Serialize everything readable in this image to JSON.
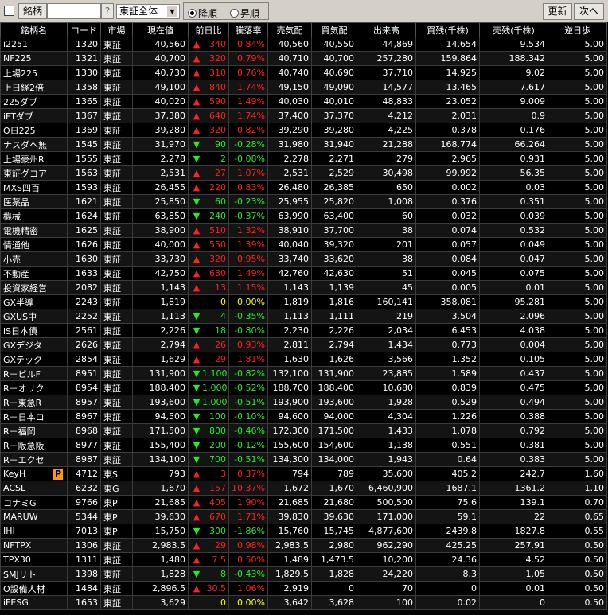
{
  "toolbar": {
    "name_label": "銘柄",
    "name_input_value": "",
    "help_label": "?",
    "market_select": "東証全体",
    "sort_desc": "降順",
    "sort_asc": "昇順",
    "refresh": "更新",
    "next": "次へ"
  },
  "columns": [
    "銘柄名",
    "コード",
    "市場",
    "現在値",
    "前日比",
    "騰落率",
    "売気配",
    "買気配",
    "出来高",
    "買残(千株)",
    "売残(千株)",
    "逆日歩"
  ],
  "rows": [
    {
      "name": "i2251",
      "code": "1320",
      "market": "東証",
      "price": "40,560",
      "dir": "up",
      "change": "340",
      "rate": "0.84%",
      "ask": "40,560",
      "bid": "40,550",
      "volume": "44,869",
      "buy_rem": "14.654",
      "sell_rem": "9.534",
      "fee": "5.00"
    },
    {
      "name": "NF225",
      "code": "1321",
      "market": "東証",
      "price": "40,700",
      "dir": "up",
      "change": "320",
      "rate": "0.79%",
      "ask": "40,710",
      "bid": "40,700",
      "volume": "257,280",
      "buy_rem": "159.864",
      "sell_rem": "188.342",
      "fee": "5.00"
    },
    {
      "name": "上場225",
      "code": "1330",
      "market": "東証",
      "price": "40,730",
      "dir": "up",
      "change": "310",
      "rate": "0.76%",
      "ask": "40,740",
      "bid": "40,690",
      "volume": "37,710",
      "buy_rem": "14.925",
      "sell_rem": "9.02",
      "fee": "5.00"
    },
    {
      "name": "上日経2倍",
      "code": "1358",
      "market": "東証",
      "price": "49,100",
      "dir": "up",
      "change": "840",
      "rate": "1.74%",
      "ask": "49,150",
      "bid": "49,090",
      "volume": "14,577",
      "buy_rem": "13.465",
      "sell_rem": "7.617",
      "fee": "5.00"
    },
    {
      "name": "225ダブ",
      "code": "1365",
      "market": "東証",
      "price": "40,020",
      "dir": "up",
      "change": "590",
      "rate": "1.49%",
      "ask": "40,030",
      "bid": "40,010",
      "volume": "48,833",
      "buy_rem": "23.052",
      "sell_rem": "9.009",
      "fee": "5.00"
    },
    {
      "name": "iFTダブ",
      "code": "1367",
      "market": "東証",
      "price": "37,380",
      "dir": "up",
      "change": "640",
      "rate": "1.74%",
      "ask": "37,400",
      "bid": "37,370",
      "volume": "4,212",
      "buy_rem": "2.031",
      "sell_rem": "0.9",
      "fee": "5.00"
    },
    {
      "name": "O日225",
      "code": "1369",
      "market": "東証",
      "price": "39,280",
      "dir": "up",
      "change": "320",
      "rate": "0.82%",
      "ask": "39,290",
      "bid": "39,280",
      "volume": "4,225",
      "buy_rem": "0.378",
      "sell_rem": "0.176",
      "fee": "5.00"
    },
    {
      "name": "ナスダヘ無",
      "code": "1545",
      "market": "東証",
      "price": "31,970",
      "dir": "dn",
      "change": "90",
      "rate": "-0.28%",
      "ask": "31,980",
      "bid": "31,940",
      "volume": "21,288",
      "buy_rem": "168.774",
      "sell_rem": "66.264",
      "fee": "5.00"
    },
    {
      "name": "上場豪州R",
      "code": "1555",
      "market": "東証",
      "price": "2,278",
      "dir": "dn",
      "change": "2",
      "rate": "-0.08%",
      "ask": "2,278",
      "bid": "2,271",
      "volume": "279",
      "buy_rem": "2.965",
      "sell_rem": "0.931",
      "fee": "5.00"
    },
    {
      "name": "東証グコア",
      "code": "1563",
      "market": "東証",
      "price": "2,531",
      "dir": "up",
      "change": "27",
      "rate": "1.07%",
      "ask": "2,531",
      "bid": "2,529",
      "volume": "30,498",
      "buy_rem": "99.992",
      "sell_rem": "56.35",
      "fee": "5.00"
    },
    {
      "name": "MXS四百",
      "code": "1593",
      "market": "東証",
      "price": "26,455",
      "dir": "up",
      "change": "220",
      "rate": "0.83%",
      "ask": "26,480",
      "bid": "26,385",
      "volume": "650",
      "buy_rem": "0.002",
      "sell_rem": "0.03",
      "fee": "5.00"
    },
    {
      "name": "医薬品",
      "code": "1621",
      "market": "東証",
      "price": "25,850",
      "dir": "dn",
      "change": "60",
      "rate": "-0.23%",
      "ask": "25,955",
      "bid": "25,820",
      "volume": "1,008",
      "buy_rem": "0.376",
      "sell_rem": "0.351",
      "fee": "5.00"
    },
    {
      "name": "機械",
      "code": "1624",
      "market": "東証",
      "price": "63,850",
      "dir": "dn",
      "change": "240",
      "rate": "-0.37%",
      "ask": "63,990",
      "bid": "63,400",
      "volume": "60",
      "buy_rem": "0.032",
      "sell_rem": "0.039",
      "fee": "5.00"
    },
    {
      "name": "電機精密",
      "code": "1625",
      "market": "東証",
      "price": "38,900",
      "dir": "up",
      "change": "510",
      "rate": "1.32%",
      "ask": "38,910",
      "bid": "37,700",
      "volume": "38",
      "buy_rem": "0.074",
      "sell_rem": "0.532",
      "fee": "5.00"
    },
    {
      "name": "情通他",
      "code": "1626",
      "market": "東証",
      "price": "40,000",
      "dir": "up",
      "change": "550",
      "rate": "1.39%",
      "ask": "40,040",
      "bid": "39,320",
      "volume": "201",
      "buy_rem": "0.057",
      "sell_rem": "0.049",
      "fee": "5.00"
    },
    {
      "name": "小売",
      "code": "1630",
      "market": "東証",
      "price": "33,730",
      "dir": "up",
      "change": "320",
      "rate": "0.95%",
      "ask": "33,740",
      "bid": "33,620",
      "volume": "38",
      "buy_rem": "0.084",
      "sell_rem": "0.047",
      "fee": "5.00"
    },
    {
      "name": "不動産",
      "code": "1633",
      "market": "東証",
      "price": "42,750",
      "dir": "up",
      "change": "630",
      "rate": "1.49%",
      "ask": "42,760",
      "bid": "42,630",
      "volume": "51",
      "buy_rem": "0.045",
      "sell_rem": "0.075",
      "fee": "5.00"
    },
    {
      "name": "投資家経営",
      "code": "2082",
      "market": "東証",
      "price": "1,143",
      "dir": "up",
      "change": "13",
      "rate": "1.15%",
      "ask": "1,143",
      "bid": "1,139",
      "volume": "45",
      "buy_rem": "0.005",
      "sell_rem": "0.01",
      "fee": "5.00"
    },
    {
      "name": "GX半導",
      "code": "2243",
      "market": "東証",
      "price": "1,819",
      "dir": "flat",
      "change": "0",
      "rate": "0.00%",
      "ask": "1,819",
      "bid": "1,816",
      "volume": "160,141",
      "buy_rem": "358.081",
      "sell_rem": "95.281",
      "fee": "5.00"
    },
    {
      "name": "GXUS中",
      "code": "2252",
      "market": "東証",
      "price": "1,113",
      "dir": "dn",
      "change": "4",
      "rate": "-0.35%",
      "ask": "1,113",
      "bid": "1,111",
      "volume": "219",
      "buy_rem": "3.504",
      "sell_rem": "2.096",
      "fee": "5.00"
    },
    {
      "name": "iS日本債",
      "code": "2561",
      "market": "東証",
      "price": "2,226",
      "dir": "dn",
      "change": "18",
      "rate": "-0.80%",
      "ask": "2,230",
      "bid": "2,226",
      "volume": "2,034",
      "buy_rem": "6.453",
      "sell_rem": "4.038",
      "fee": "5.00"
    },
    {
      "name": "GXデジタ",
      "code": "2626",
      "market": "東証",
      "price": "2,794",
      "dir": "up",
      "change": "26",
      "rate": "0.93%",
      "ask": "2,811",
      "bid": "2,794",
      "volume": "1,434",
      "buy_rem": "0.773",
      "sell_rem": "0.004",
      "fee": "5.00"
    },
    {
      "name": "GXテック",
      "code": "2854",
      "market": "東証",
      "price": "1,629",
      "dir": "up",
      "change": "29",
      "rate": "1.81%",
      "ask": "1,630",
      "bid": "1,626",
      "volume": "3,566",
      "buy_rem": "1.352",
      "sell_rem": "0.105",
      "fee": "5.00"
    },
    {
      "name": "R－ビルF",
      "code": "8951",
      "market": "東証",
      "price": "131,900",
      "dir": "dn",
      "change": "1,100",
      "rate": "-0.82%",
      "ask": "132,100",
      "bid": "131,900",
      "volume": "23,885",
      "buy_rem": "1.589",
      "sell_rem": "0.437",
      "fee": "5.00"
    },
    {
      "name": "R－オリク",
      "code": "8954",
      "market": "東証",
      "price": "188,400",
      "dir": "dn",
      "change": "1,000",
      "rate": "-0.52%",
      "ask": "188,700",
      "bid": "188,400",
      "volume": "10,680",
      "buy_rem": "0.839",
      "sell_rem": "0.475",
      "fee": "5.00"
    },
    {
      "name": "R－東急R",
      "code": "8957",
      "market": "東証",
      "price": "193,600",
      "dir": "dn",
      "change": "1,000",
      "rate": "-0.51%",
      "ask": "193,900",
      "bid": "193,600",
      "volume": "1,928",
      "buy_rem": "0.529",
      "sell_rem": "0.494",
      "fee": "5.00"
    },
    {
      "name": "R－日本ロ",
      "code": "8967",
      "market": "東証",
      "price": "94,500",
      "dir": "dn",
      "change": "100",
      "rate": "-0.10%",
      "ask": "94,600",
      "bid": "94,000",
      "volume": "4,304",
      "buy_rem": "1.226",
      "sell_rem": "0.388",
      "fee": "5.00"
    },
    {
      "name": "R－福岡",
      "code": "8968",
      "market": "東証",
      "price": "171,500",
      "dir": "dn",
      "change": "800",
      "rate": "-0.46%",
      "ask": "172,300",
      "bid": "171,500",
      "volume": "1,433",
      "buy_rem": "1.078",
      "sell_rem": "0.792",
      "fee": "5.00"
    },
    {
      "name": "R－阪急阪",
      "code": "8977",
      "market": "東証",
      "price": "155,400",
      "dir": "dn",
      "change": "200",
      "rate": "-0.12%",
      "ask": "155,600",
      "bid": "154,600",
      "volume": "1,138",
      "buy_rem": "0.551",
      "sell_rem": "0.381",
      "fee": "5.00"
    },
    {
      "name": "R－エクセ",
      "code": "8987",
      "market": "東証",
      "price": "134,100",
      "dir": "dn",
      "change": "700",
      "rate": "-0.51%",
      "ask": "134,300",
      "bid": "134,000",
      "volume": "1,943",
      "buy_rem": "0.64",
      "sell_rem": "0.383",
      "fee": "5.00"
    },
    {
      "name": "KeyH",
      "badge": "P",
      "code": "4712",
      "market": "東S",
      "price": "793",
      "dir": "up",
      "change": "3",
      "rate": "0.37%",
      "ask": "794",
      "bid": "789",
      "volume": "35,600",
      "buy_rem": "405.2",
      "sell_rem": "242.7",
      "fee": "1.60"
    },
    {
      "name": "ACSL",
      "code": "6232",
      "market": "東G",
      "price": "1,670",
      "dir": "up",
      "change": "157",
      "rate": "10.37%",
      "ask": "1,672",
      "bid": "1,670",
      "volume": "6,460,900",
      "buy_rem": "1687.1",
      "sell_rem": "1361.2",
      "fee": "1.10"
    },
    {
      "name": "コナミG",
      "code": "9766",
      "market": "東P",
      "price": "21,685",
      "dir": "up",
      "change": "405",
      "rate": "1.90%",
      "ask": "21,685",
      "bid": "21,680",
      "volume": "500,500",
      "buy_rem": "75.6",
      "sell_rem": "139.1",
      "fee": "0.70"
    },
    {
      "name": "MARUW",
      "code": "5344",
      "market": "東P",
      "price": "39,630",
      "dir": "up",
      "change": "670",
      "rate": "1.71%",
      "ask": "39,830",
      "bid": "39,630",
      "volume": "171,000",
      "buy_rem": "59.1",
      "sell_rem": "22",
      "fee": "0.65"
    },
    {
      "name": "IHI",
      "code": "7013",
      "market": "東P",
      "price": "15,750",
      "dir": "dn",
      "change": "300",
      "rate": "-1.86%",
      "ask": "15,760",
      "bid": "15,745",
      "volume": "4,877,600",
      "buy_rem": "2439.8",
      "sell_rem": "1827.8",
      "fee": "0.55"
    },
    {
      "name": "NFTPX",
      "code": "1306",
      "market": "東証",
      "price": "2,983.5",
      "dir": "up",
      "change": "29",
      "rate": "0.98%",
      "ask": "2,983.5",
      "bid": "2,980",
      "volume": "962,290",
      "buy_rem": "425.25",
      "sell_rem": "257.91",
      "fee": "0.50"
    },
    {
      "name": "TPX30",
      "code": "1311",
      "market": "東証",
      "price": "1,480",
      "dir": "up",
      "change": "7.5",
      "rate": "0.50%",
      "ask": "1,489",
      "bid": "1,473.5",
      "volume": "10,200",
      "buy_rem": "24.36",
      "sell_rem": "4.52",
      "fee": "0.50"
    },
    {
      "name": "SMJリト",
      "code": "1398",
      "market": "東証",
      "price": "1,828",
      "dir": "dn",
      "change": "8",
      "rate": "-0.43%",
      "ask": "1,829.5",
      "bid": "1,828",
      "volume": "24,220",
      "buy_rem": "8.3",
      "sell_rem": "1.05",
      "fee": "0.50"
    },
    {
      "name": "O設備人材",
      "code": "1484",
      "market": "東証",
      "price": "2,896.5",
      "dir": "up",
      "change": "30.5",
      "rate": "1.06%",
      "ask": "2,919",
      "bid": "0",
      "volume": "70",
      "buy_rem": "0",
      "sell_rem": "0.01",
      "fee": "0.50"
    },
    {
      "name": "iFESG",
      "code": "1653",
      "market": "東証",
      "price": "3,629",
      "dir": "flat",
      "change": "0",
      "rate": "0.00%",
      "ask": "3,642",
      "bid": "3,628",
      "volume": "100",
      "buy_rem": "0.02",
      "sell_rem": "0",
      "fee": "0.50"
    }
  ]
}
